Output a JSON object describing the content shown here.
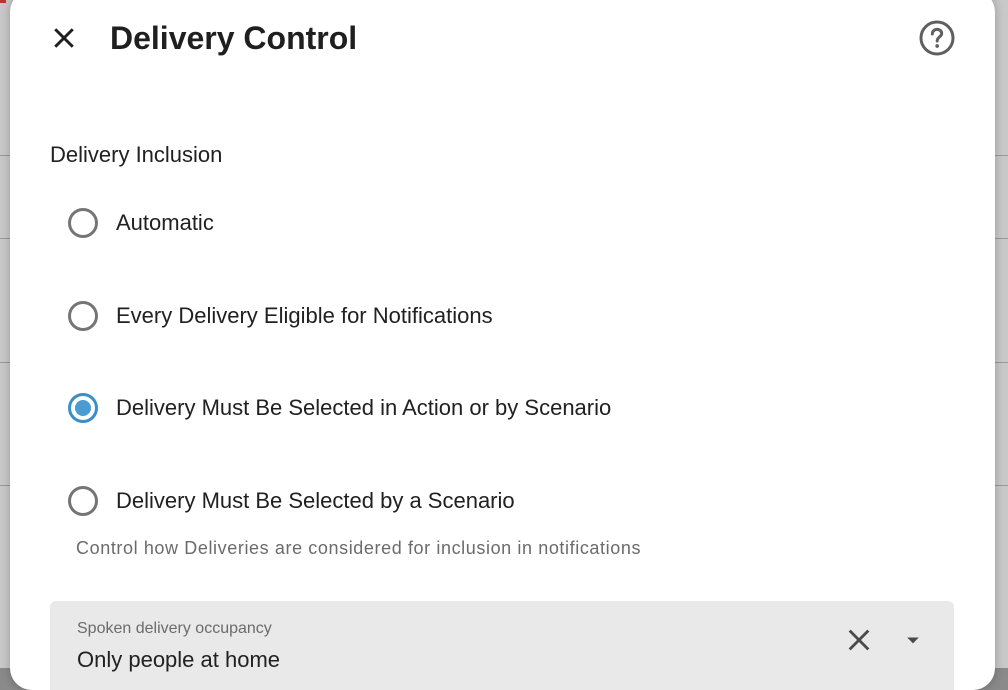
{
  "dialog": {
    "title": "Delivery Control",
    "close_icon": "close-icon",
    "help_icon": "help-circle-icon"
  },
  "delivery_inclusion": {
    "label": "Delivery Inclusion",
    "options": [
      {
        "label": "Automatic",
        "checked": false
      },
      {
        "label": "Every Delivery Eligible for Notifications",
        "checked": false
      },
      {
        "label": "Delivery Must Be Selected in Action or by Scenario",
        "checked": true
      },
      {
        "label": "Delivery Must Be Selected by a Scenario",
        "checked": false
      }
    ],
    "helper": "Control how Deliveries are considered for inclusion in notifications"
  },
  "occupancy_select": {
    "caption": "Spoken delivery occupancy",
    "value": "Only people at home",
    "clear_icon": "clear-icon",
    "dropdown_icon": "dropdown-arrow-icon"
  },
  "colors": {
    "accent": "#4a9bd0",
    "field_bg": "#e9e9e9",
    "text": "#212121",
    "helper_text": "#6b6b6b"
  }
}
